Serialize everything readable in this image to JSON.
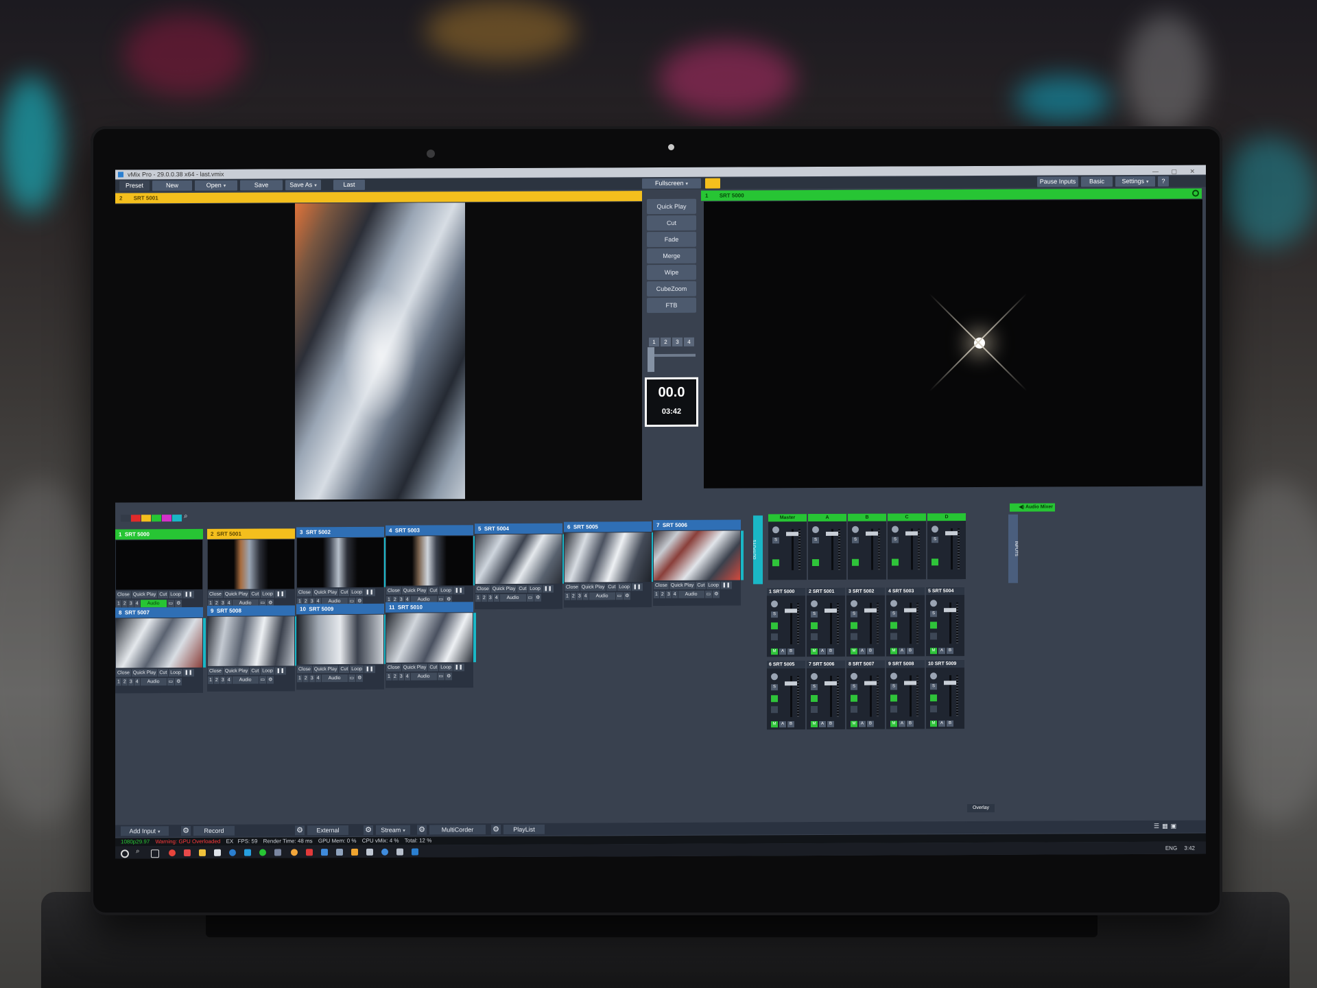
{
  "window": {
    "title": "vMix Pro - 29.0.0.38 x64 - last.vmix"
  },
  "menu": {
    "preset": "Preset",
    "new": "New",
    "open": "Open",
    "save": "Save",
    "save_as": "Save As",
    "last": "Last",
    "fullscreen": "Fullscreen",
    "pause_inputs": "Pause Inputs",
    "basic": "Basic",
    "settings": "Settings",
    "help": "?"
  },
  "preview": {
    "number": "2",
    "name": "SRT 5001"
  },
  "output": {
    "number": "1",
    "name": "SRT 5000"
  },
  "transitions": {
    "quick_play": "Quick Play",
    "cut": "Cut",
    "fade": "Fade",
    "merge": "Merge",
    "wipe": "Wipe",
    "cubezoom": "CubeZoom",
    "ftb": "FTB",
    "numbers": [
      "1",
      "2",
      "3",
      "4"
    ]
  },
  "timer": {
    "value": "00.0",
    "time": "03:42"
  },
  "tile_controls": {
    "close": "Close",
    "quick_play": "Quick Play",
    "cut": "Cut",
    "loop": "Loop",
    "audio": "Audio",
    "nums": [
      "1",
      "2",
      "3",
      "4"
    ]
  },
  "inputs": [
    {
      "number": "1",
      "name": "SRT 5000",
      "state": "output"
    },
    {
      "number": "2",
      "name": "SRT 5001",
      "state": "preview"
    },
    {
      "number": "3",
      "name": "SRT 5002",
      "state": "normal"
    },
    {
      "number": "4",
      "name": "SRT 5003",
      "state": "normal"
    },
    {
      "number": "5",
      "name": "SRT 5004",
      "state": "normal"
    },
    {
      "number": "6",
      "name": "SRT 5005",
      "state": "normal"
    },
    {
      "number": "7",
      "name": "SRT 5006",
      "state": "normal"
    },
    {
      "number": "8",
      "name": "SRT 5007",
      "state": "normal"
    },
    {
      "number": "9",
      "name": "SRT 5008",
      "state": "normal"
    },
    {
      "number": "10",
      "name": "SRT 5009",
      "state": "normal"
    },
    {
      "number": "11",
      "name": "SRT 5010",
      "state": "normal"
    }
  ],
  "audio_mixer": {
    "title": "Audio Mixer",
    "outputs_label": "OUTPUTS",
    "inputs_label": "INPUTS",
    "buses": [
      "Master",
      "A",
      "B",
      "C",
      "D"
    ],
    "channels": [
      {
        "number": "1",
        "name": "SRT 5000"
      },
      {
        "number": "2",
        "name": "SRT 5001"
      },
      {
        "number": "3",
        "name": "SRT 5002"
      },
      {
        "number": "4",
        "name": "SRT 5003"
      },
      {
        "number": "5",
        "name": "SRT 5004"
      },
      {
        "number": "6",
        "name": "SRT 5005"
      },
      {
        "number": "7",
        "name": "SRT 5006"
      },
      {
        "number": "8",
        "name": "SRT 5007"
      },
      {
        "number": "9",
        "name": "SRT 5008"
      },
      {
        "number": "10",
        "name": "SRT 5009"
      }
    ],
    "bus_buttons": [
      "M",
      "A",
      "B"
    ],
    "overlay": "Overlay"
  },
  "bottom_bar": {
    "add_input": "Add Input",
    "record": "Record",
    "external": "External",
    "stream": "Stream",
    "multicorder": "MultiCorder",
    "playlist": "PlayList"
  },
  "status": {
    "format": "1080p29.97",
    "warning": "Warning: GPU Overloaded",
    "ex": "EX",
    "fps": "FPS: 59",
    "render": "Render Time: 48 ms",
    "gpu": "GPU Mem: 0 %",
    "cpu": "CPU vMix: 4 %",
    "total": "Total: 12 %"
  },
  "taskbar": {
    "lang": "ENG",
    "clock": "3:42"
  },
  "colors": {
    "preview": "#f4bf1d",
    "output": "#27c534",
    "accent": "#1ab7c6",
    "panel": "#39414f"
  }
}
